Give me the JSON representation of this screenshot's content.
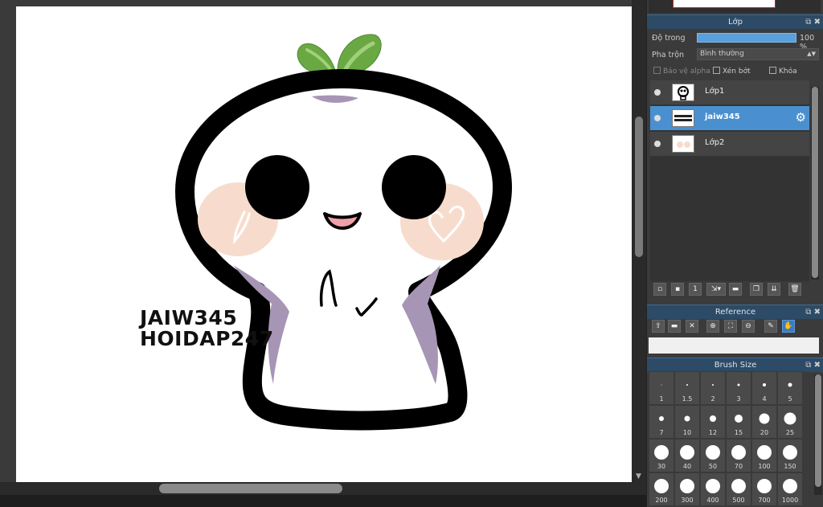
{
  "canvas": {
    "watermark_line1": "JAIW345",
    "watermark_line2": "HOIDAP247"
  },
  "layers_panel": {
    "title": "Lớp",
    "opacity_label": "Độ trong",
    "opacity_value": "100 %",
    "opacity_fraction": 1.0,
    "blend_label": "Pha trộn",
    "blend_value": "Bình thường",
    "protect_alpha_label": "Bảo vệ alpha",
    "clipping_label": "Xén bớt",
    "lock_label": "Khóa",
    "layers": [
      {
        "name": "Lớp1",
        "selected": false
      },
      {
        "name": "jaiw345",
        "selected": true
      },
      {
        "name": "Lớp2",
        "selected": false
      }
    ]
  },
  "reference_panel": {
    "title": "Reference"
  },
  "brush_size_panel": {
    "title": "Brush Size",
    "sizes": [
      "1",
      "1.5",
      "2",
      "3",
      "4",
      "5",
      "7",
      "10",
      "12",
      "15",
      "20",
      "25",
      "30",
      "40",
      "50",
      "70",
      "100",
      "150",
      "200",
      "300",
      "400",
      "500",
      "700",
      "1000"
    ]
  },
  "colors": {
    "accent": "#4a90d0",
    "panel_header": "#2d4a66",
    "leaf_green": "#6aa843",
    "blush": "#f7dccd",
    "shadow_purple": "#a795b5"
  }
}
